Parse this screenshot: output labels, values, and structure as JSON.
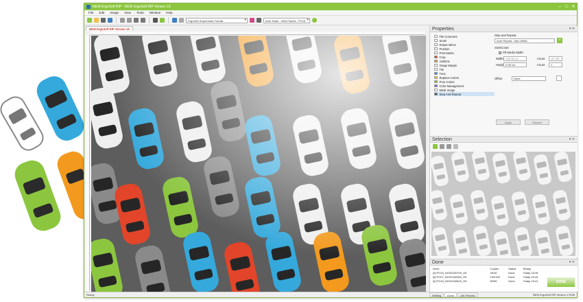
{
  "window": {
    "title": "NEW ErgoSoft RIP - NEW ErgoSoft RIP Version 15",
    "minimize": "–",
    "maximize": "□",
    "close": "✕"
  },
  "menu": [
    "File",
    "Edit",
    "Image",
    "View",
    "Tools",
    "Window",
    "Help"
  ],
  "toolbar": {
    "format_select": "ErgoSoft Supermode Format",
    "scale_select": "Auto Scale - Web Panels - PO16"
  },
  "doc_tab": "NEW ErgoSoft RIP Version 15",
  "properties": {
    "title": "Properties",
    "items": [
      {
        "label": "File Comment",
        "color": "#ffffff"
      },
      {
        "label": "Scale",
        "color": "#ffffff"
      },
      {
        "label": "Rotate Mirror",
        "color": "#ffffff"
      },
      {
        "label": "Position",
        "color": "#ffffff"
      },
      {
        "label": "Print Marks",
        "color": "#ffffff"
      },
      {
        "label": "Crop",
        "color": "#e04a2a"
      },
      {
        "label": "AddOns",
        "color": "#d9a23a"
      },
      {
        "label": "Image Margin",
        "color": "#ffffff"
      },
      {
        "label": "Tile",
        "color": "#ffffff"
      },
      {
        "label": "Tune",
        "color": "#3f8dd1"
      },
      {
        "label": "Replace Colors",
        "color": "#f1c232"
      },
      {
        "label": "Pure Colors",
        "color": "#8cc63f"
      },
      {
        "label": "Color Management",
        "color": "#8b5fbf"
      },
      {
        "label": "Mask Image",
        "color": "#ffffff"
      },
      {
        "label": "Step And Repeat",
        "color": "#4a4a4a"
      }
    ],
    "selected_index": 14,
    "step_repeat_label": "Step and Repeat",
    "mode_select": "Auto Repeat - Max Width",
    "size_count_label": "Size/Count",
    "fill_media_label": "Fill Media Width",
    "width_label": "Width",
    "width_value": "196.36 cm",
    "height_label": "Height",
    "height_value": "9.98 cm",
    "count_label": "Count",
    "count_value_1": "15.728",
    "count_value_2": "1",
    "offset_label": "Offset",
    "offset_select": "None",
    "apply_label": "Apply",
    "discard_label": "Discard"
  },
  "selection": {
    "title": "Selection"
  },
  "done": {
    "title": "Done",
    "headers": [
      "Done",
      "Copies",
      "Status",
      "Ready"
    ],
    "rows": [
      [
        "[4] PO16_NO20160709_OK",
        "30/30",
        "Done",
        "Today 15:46"
      ],
      [
        "[5] PO07_NO20160360_OK",
        "100/100",
        "Done",
        "Today 15:44"
      ],
      [
        "[4] PO15_NO20160620_OK",
        "50/50",
        "Done",
        "Today 15:41"
      ]
    ],
    "done_button": "DONE",
    "tabs": [
      "Waiting",
      "Done",
      "Job Preview"
    ]
  },
  "status": {
    "left": "Ready",
    "right": "NEW ErgoSoft RIP Version 1  RGB"
  },
  "colors": {
    "accent_green": "#8cc63f",
    "car_blue": "#35a9dc",
    "car_orange": "#f39a1e",
    "car_green": "#8cc63f",
    "car_red": "#e2452a",
    "car_gray": "#8a8a8a",
    "car_white": "#eeeeee"
  }
}
